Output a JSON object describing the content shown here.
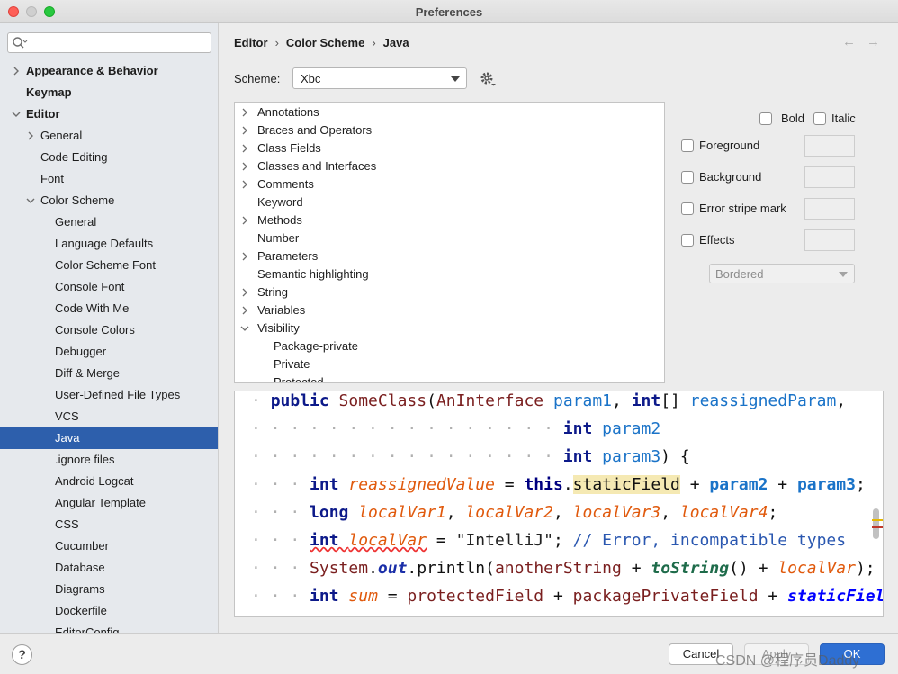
{
  "window": {
    "title": "Preferences"
  },
  "search": {
    "placeholder": ""
  },
  "sidebar": {
    "items": [
      {
        "label": "Appearance & Behavior",
        "level": 0,
        "arrow": "collapsed",
        "bold": true
      },
      {
        "label": "Keymap",
        "level": 0,
        "arrow": "none",
        "bold": true
      },
      {
        "label": "Editor",
        "level": 0,
        "arrow": "expanded",
        "bold": true
      },
      {
        "label": "General",
        "level": 1,
        "arrow": "collapsed"
      },
      {
        "label": "Code Editing",
        "level": 1,
        "arrow": "none"
      },
      {
        "label": "Font",
        "level": 1,
        "arrow": "none"
      },
      {
        "label": "Color Scheme",
        "level": 1,
        "arrow": "expanded"
      },
      {
        "label": "General",
        "level": 2,
        "arrow": "none"
      },
      {
        "label": "Language Defaults",
        "level": 2,
        "arrow": "none"
      },
      {
        "label": "Color Scheme Font",
        "level": 2,
        "arrow": "none"
      },
      {
        "label": "Console Font",
        "level": 2,
        "arrow": "none"
      },
      {
        "label": "Code With Me",
        "level": 2,
        "arrow": "none"
      },
      {
        "label": "Console Colors",
        "level": 2,
        "arrow": "none"
      },
      {
        "label": "Debugger",
        "level": 2,
        "arrow": "none"
      },
      {
        "label": "Diff & Merge",
        "level": 2,
        "arrow": "none"
      },
      {
        "label": "User-Defined File Types",
        "level": 2,
        "arrow": "none"
      },
      {
        "label": "VCS",
        "level": 2,
        "arrow": "none"
      },
      {
        "label": "Java",
        "level": 2,
        "arrow": "none",
        "selected": true
      },
      {
        "label": ".ignore files",
        "level": 2,
        "arrow": "none"
      },
      {
        "label": "Android Logcat",
        "level": 2,
        "arrow": "none"
      },
      {
        "label": "Angular Template",
        "level": 2,
        "arrow": "none"
      },
      {
        "label": "CSS",
        "level": 2,
        "arrow": "none"
      },
      {
        "label": "Cucumber",
        "level": 2,
        "arrow": "none"
      },
      {
        "label": "Database",
        "level": 2,
        "arrow": "none"
      },
      {
        "label": "Diagrams",
        "level": 2,
        "arrow": "none"
      },
      {
        "label": "Dockerfile",
        "level": 2,
        "arrow": "none"
      },
      {
        "label": "EditorConfig",
        "level": 2,
        "arrow": "none"
      }
    ]
  },
  "breadcrumb": {
    "items": [
      "Editor",
      "Color Scheme",
      "Java"
    ],
    "separator": "›"
  },
  "nav": {
    "back": "←",
    "forward": "→"
  },
  "scheme": {
    "label": "Scheme:",
    "value": "Xbc"
  },
  "attributes": {
    "items": [
      {
        "label": "Annotations",
        "arrow": "collapsed",
        "indent": 0
      },
      {
        "label": "Braces and Operators",
        "arrow": "collapsed",
        "indent": 0
      },
      {
        "label": "Class Fields",
        "arrow": "collapsed",
        "indent": 0
      },
      {
        "label": "Classes and Interfaces",
        "arrow": "collapsed",
        "indent": 0
      },
      {
        "label": "Comments",
        "arrow": "collapsed",
        "indent": 0
      },
      {
        "label": "Keyword",
        "arrow": "none",
        "indent": 0
      },
      {
        "label": "Methods",
        "arrow": "collapsed",
        "indent": 0
      },
      {
        "label": "Number",
        "arrow": "none",
        "indent": 0
      },
      {
        "label": "Parameters",
        "arrow": "collapsed",
        "indent": 0
      },
      {
        "label": "Semantic highlighting",
        "arrow": "none",
        "indent": 0
      },
      {
        "label": "String",
        "arrow": "collapsed",
        "indent": 0
      },
      {
        "label": "Variables",
        "arrow": "collapsed",
        "indent": 0
      },
      {
        "label": "Visibility",
        "arrow": "expanded",
        "indent": 0
      },
      {
        "label": "Package-private",
        "arrow": "none",
        "indent": 1
      },
      {
        "label": "Private",
        "arrow": "none",
        "indent": 1
      },
      {
        "label": "Protected",
        "arrow": "none",
        "indent": 1
      }
    ]
  },
  "options": {
    "bold": "Bold",
    "italic": "Italic",
    "foreground": "Foreground",
    "background": "Background",
    "error_stripe": "Error stripe mark",
    "effects": "Effects",
    "effects_type": "Bordered"
  },
  "code_preview": {
    "lines": [
      [
        [
          "dots",
          "· "
        ],
        [
          "kw",
          "public "
        ],
        [
          "cls",
          "SomeClass"
        ],
        [
          "plain",
          "("
        ],
        [
          "cls",
          "AnInterface "
        ],
        [
          "param",
          "param1"
        ],
        [
          "plain",
          ", "
        ],
        [
          "kw",
          "int"
        ],
        [
          "plain",
          "[] "
        ],
        [
          "param",
          "reassignedParam"
        ],
        [
          "plain",
          ","
        ]
      ],
      [
        [
          "dots",
          "· · · · · · · · · · · · · · · · "
        ],
        [
          "kw",
          "int "
        ],
        [
          "param",
          "param2"
        ]
      ],
      [
        [
          "dots",
          "· · · · · · · · · · · · · · · · "
        ],
        [
          "kw",
          "int "
        ],
        [
          "param",
          "param3"
        ],
        [
          "plain",
          ") {"
        ]
      ],
      [
        [
          "dots",
          "· · · "
        ],
        [
          "kw",
          "int "
        ],
        [
          "lvar",
          "reassignedValue"
        ],
        [
          "plain",
          " = "
        ],
        [
          "kw2",
          "this"
        ],
        [
          "plain",
          "."
        ],
        [
          "hl",
          "staticField"
        ],
        [
          "plain",
          " + "
        ],
        [
          "param-b",
          "param2"
        ],
        [
          "plain",
          " + "
        ],
        [
          "param-b",
          "param3"
        ],
        [
          "plain",
          ";"
        ]
      ],
      [
        [
          "dots",
          "· · · "
        ],
        [
          "kw",
          "long "
        ],
        [
          "lvar",
          "localVar1"
        ],
        [
          "plain",
          ", "
        ],
        [
          "lvar",
          "localVar2"
        ],
        [
          "plain",
          ", "
        ],
        [
          "lvar",
          "localVar3"
        ],
        [
          "plain",
          ", "
        ],
        [
          "lvar",
          "localVar4"
        ],
        [
          "plain",
          ";"
        ]
      ],
      [
        [
          "dots",
          "· · · "
        ],
        [
          "squig",
          "int "
        ],
        [
          "lvarsq",
          "localVar"
        ],
        [
          "plain",
          " = "
        ],
        [
          "str",
          "\"IntelliJ\""
        ],
        [
          "plain",
          "; "
        ],
        [
          "cmt",
          "// Error, incompatible types"
        ]
      ],
      [
        [
          "dots",
          "· · · "
        ],
        [
          "cls",
          "System"
        ],
        [
          "plain",
          "."
        ],
        [
          "out",
          "out"
        ],
        [
          "plain",
          ".println("
        ],
        [
          "fld",
          "anotherString"
        ],
        [
          "plain",
          " + "
        ],
        [
          "mth",
          "toString"
        ],
        [
          "plain",
          "() + "
        ],
        [
          "lvar",
          "localVar"
        ],
        [
          "plain",
          ");"
        ]
      ],
      [
        [
          "dots",
          "· · · "
        ],
        [
          "kw",
          "int "
        ],
        [
          "lvar",
          "sum"
        ],
        [
          "plain",
          " = "
        ],
        [
          "fld",
          "protectedField"
        ],
        [
          "plain",
          " + "
        ],
        [
          "fld",
          "packagePrivateField"
        ],
        [
          "plain",
          " + "
        ],
        [
          "sfld",
          "staticField"
        ],
        [
          "plain",
          ";"
        ]
      ]
    ]
  },
  "footer": {
    "help": "?",
    "cancel": "Cancel",
    "apply": "Apply",
    "ok": "OK",
    "watermark": "CSDN @程序员Daddy"
  },
  "colors": {
    "accent": "#2d5fac",
    "ok_button": "#2e6fd3"
  }
}
